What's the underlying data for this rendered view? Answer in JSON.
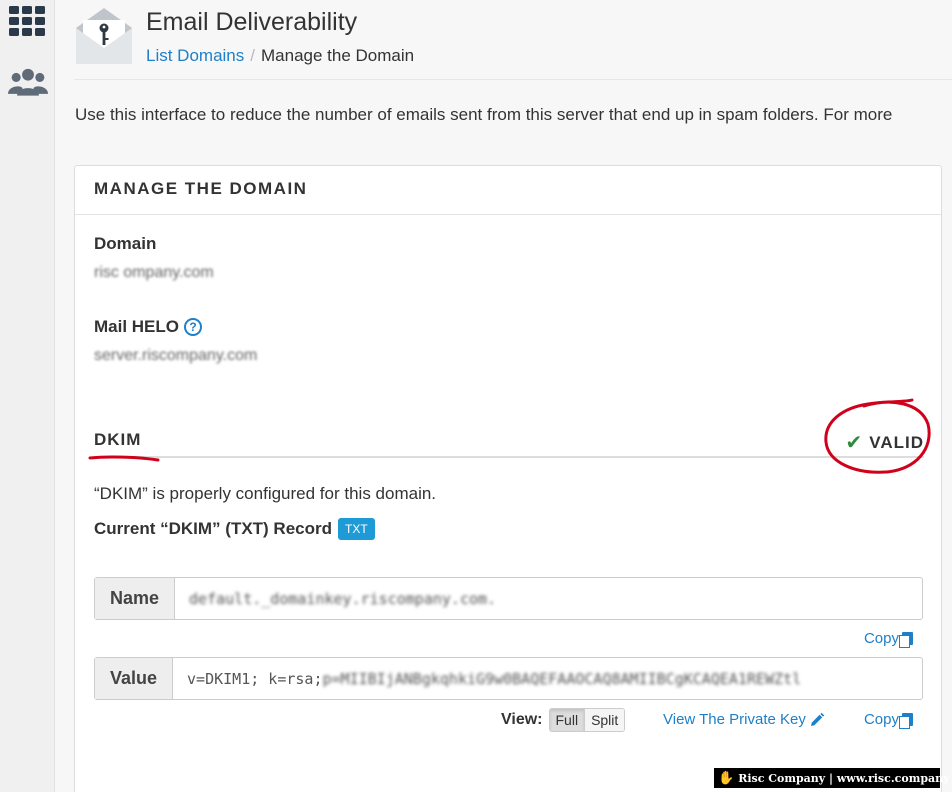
{
  "sidebar": {
    "items": [
      {
        "icon": "apps-grid-icon"
      },
      {
        "icon": "users-icon"
      }
    ]
  },
  "header": {
    "title": "Email Deliverability",
    "breadcrumb": {
      "link": "List Domains",
      "separator": "/",
      "current": "Manage the Domain"
    }
  },
  "intro": "Use this interface to reduce the number of emails sent from this server that end up in spam folders. For more",
  "panel": {
    "heading": "MANAGE THE DOMAIN",
    "domain_label": "Domain",
    "domain_value": "risc ompany.com",
    "helo_label": "Mail HELO",
    "helo_value": "server.riscompany.com",
    "dkim": {
      "title": "DKIM",
      "status": "VALID",
      "description": "“DKIM” is properly configured for this domain.",
      "record_label": "Current “DKIM” (TXT) Record",
      "record_badge": "TXT",
      "name_label": "Name",
      "name_value": "default._domainkey.riscompany.com.",
      "value_label": "Value",
      "value_prefix": "v=DKIM1; k=rsa; ",
      "value_rest": "p=MIIBIjANBgkqhkiG9w0BAQEFAAOCAQ8AMIIBCgKCAQEA1REWZtl",
      "copy_label": "Copy",
      "view_label": "View:",
      "view_full": "Full",
      "view_split": "Split",
      "private_key_label": "View The Private Key"
    }
  },
  "annotation_color": "#d0021b",
  "accent_color": "#1e80c8",
  "watermark": "Risc Company | www.risc.company"
}
